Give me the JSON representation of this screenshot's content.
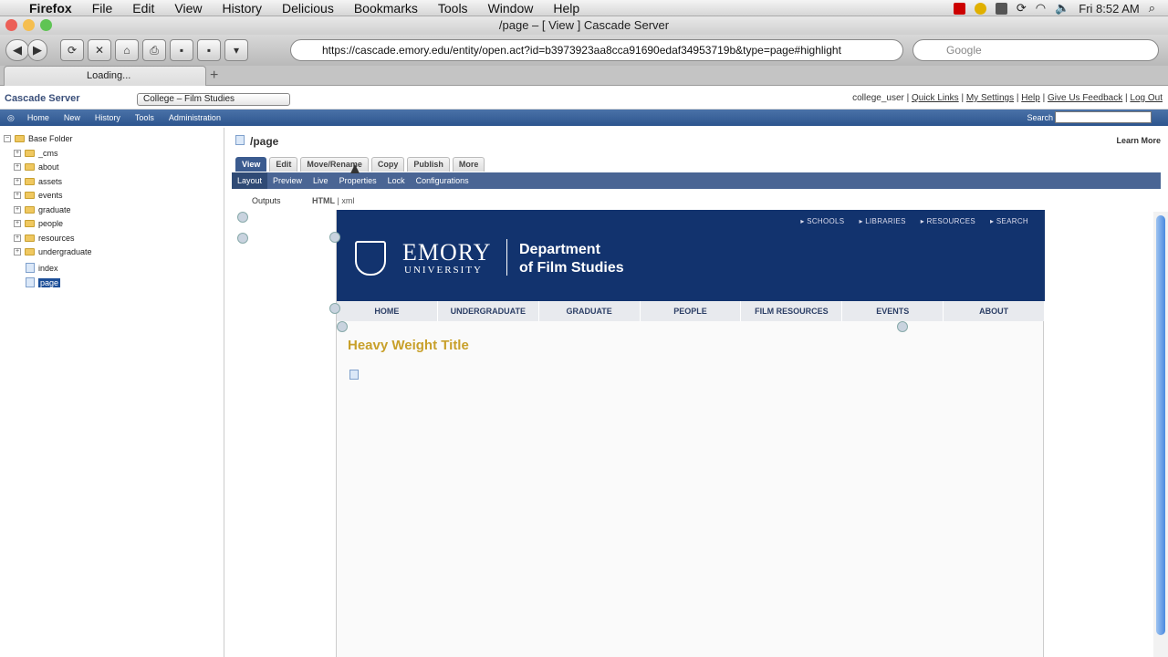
{
  "mac_menu": [
    "Firefox",
    "File",
    "Edit",
    "View",
    "History",
    "Delicious",
    "Bookmarks",
    "Tools",
    "Window",
    "Help"
  ],
  "clock": "Fri 8:52 AM",
  "window_title": "/page – [ View ] Cascade Server",
  "url": "https://cascade.emory.edu/entity/open.act?id=b3973923aa8cca91690edaf34953719b&type=page#highlight",
  "search_placeholder": "Google",
  "tab_label": "Loading...",
  "cms": {
    "logo": "Cascade Server",
    "site": "College – Film Studies",
    "user": "college_user",
    "links": [
      "Quick Links",
      "My Settings",
      "Help",
      "Give Us Feedback",
      "Log Out"
    ],
    "menu": [
      "Home",
      "New",
      "History",
      "Tools",
      "Administration"
    ],
    "search_label": "Search"
  },
  "tree": {
    "root": "Base Folder",
    "folders": [
      "_cms",
      "about",
      "assets",
      "events",
      "graduate",
      "people",
      "resources",
      "undergraduate"
    ],
    "pages": [
      "index",
      "page"
    ]
  },
  "page": {
    "title": "/page",
    "learn_more": "Learn More",
    "tabs": [
      "View",
      "Edit",
      "Move/Rename",
      "Copy",
      "Publish",
      "More"
    ],
    "subtabs": [
      "Layout",
      "Preview",
      "Live",
      "Properties",
      "Lock",
      "Configurations"
    ],
    "outputs_label": "Outputs",
    "outputs": [
      "HTML",
      "xml"
    ]
  },
  "emory": {
    "topnav": [
      "SCHOOLS",
      "LIBRARIES",
      "RESOURCES",
      "SEARCH"
    ],
    "name": "EMORY",
    "university": "UNIVERSITY",
    "dept_line1": "Department",
    "dept_line2": "of Film Studies",
    "menu": [
      "HOME",
      "UNDERGRADUATE",
      "GRADUATE",
      "PEOPLE",
      "FILM RESOURCES",
      "EVENTS",
      "ABOUT"
    ],
    "heading": "Heavy Weight Title"
  }
}
